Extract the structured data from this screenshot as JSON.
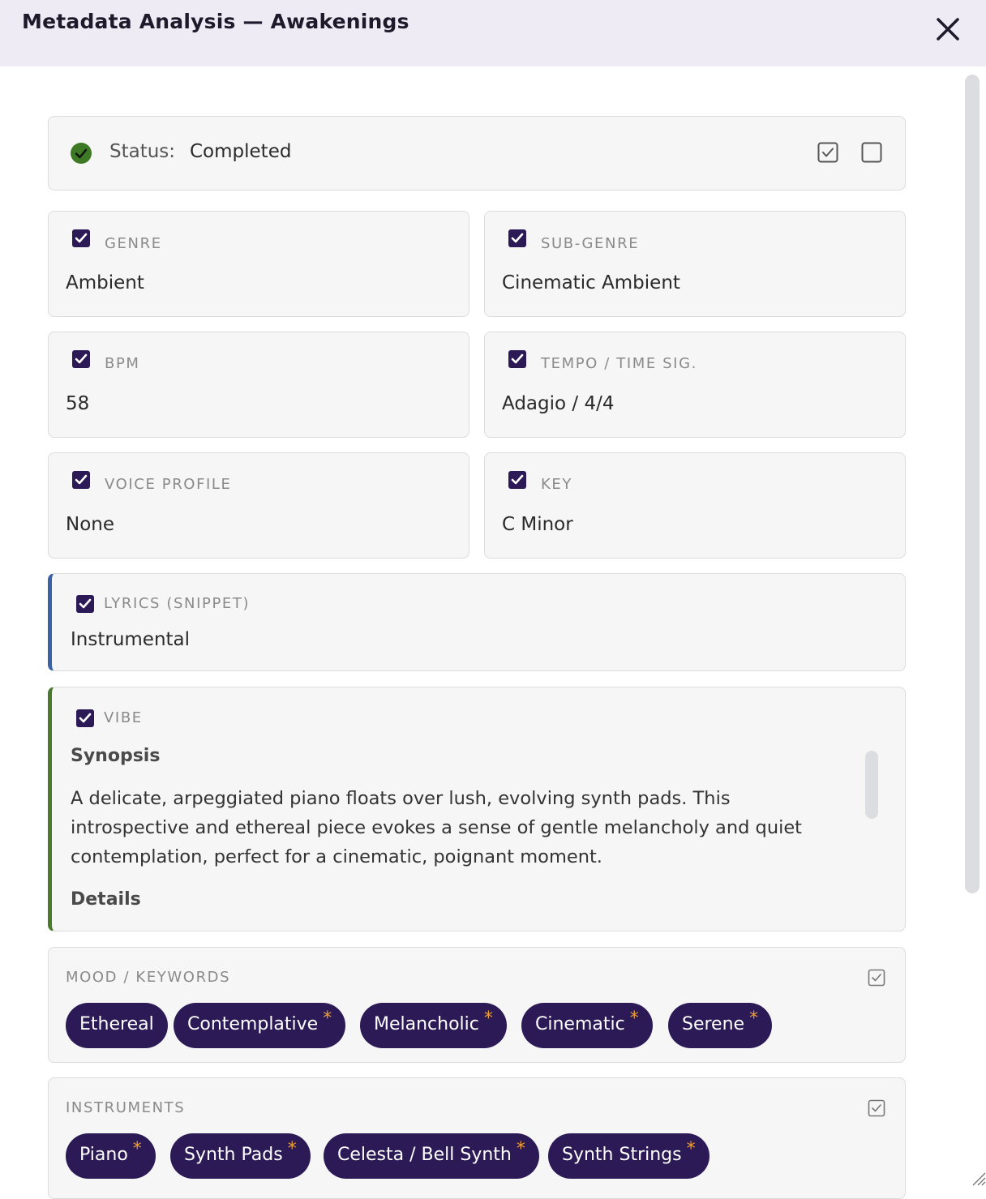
{
  "dialog": {
    "title": "Metadata Analysis — Awakenings",
    "close_icon": "close-icon"
  },
  "status": {
    "label": "Status:",
    "value": "Completed",
    "icon": "check-circle-icon",
    "icon_color": "#3e7a26"
  },
  "fields": [
    {
      "label": "GENRE",
      "value": "Ambient",
      "checked": true
    },
    {
      "label": "SUB-GENRE",
      "value": "Cinematic Ambient",
      "checked": true
    },
    {
      "label": "BPM",
      "value": "58",
      "checked": true
    },
    {
      "label": "TEMPO / TIME SIG.",
      "value": "Adagio / 4/4",
      "checked": true
    },
    {
      "label": "VOICE PROFILE",
      "value": "None",
      "checked": true
    },
    {
      "label": "KEY",
      "value": "C Minor",
      "checked": true
    }
  ],
  "lyrics": {
    "label": "LYRICS (SNIPPET)",
    "value": "Instrumental",
    "accent_color": "#3c62a6"
  },
  "vibe": {
    "label": "VIBE",
    "synopsis_heading": "Synopsis",
    "synopsis_text": "A delicate, arpeggiated piano floats over lush, evolving synth pads. This introspective and ethereal piece evokes a sense of gentle melancholy and quiet contemplation, perfect for a cinematic, poignant moment.",
    "details_heading": "Details",
    "accent_color": "#4a7a2c"
  },
  "mood": {
    "label": "MOOD / KEYWORDS",
    "tags": [
      {
        "text": "Ethereal",
        "star": ""
      },
      {
        "text": "Contemplative",
        "star": "*"
      },
      {
        "text": "Melancholic",
        "star": "*"
      },
      {
        "text": "Cinematic",
        "star": "*"
      },
      {
        "text": "Serene",
        "star": "*"
      }
    ]
  },
  "instruments": {
    "label": "INSTRUMENTS",
    "tags": [
      {
        "text": "Piano",
        "star": "*"
      },
      {
        "text": "Synth Pads",
        "star": "*"
      },
      {
        "text": "Celesta / Bell Synth",
        "star": "*"
      },
      {
        "text": "Synth Strings",
        "star": "*"
      }
    ]
  },
  "colors": {
    "header_bg": "#efebf5",
    "accent_purple": "#2b1a55",
    "star_orange": "#f0a030"
  }
}
